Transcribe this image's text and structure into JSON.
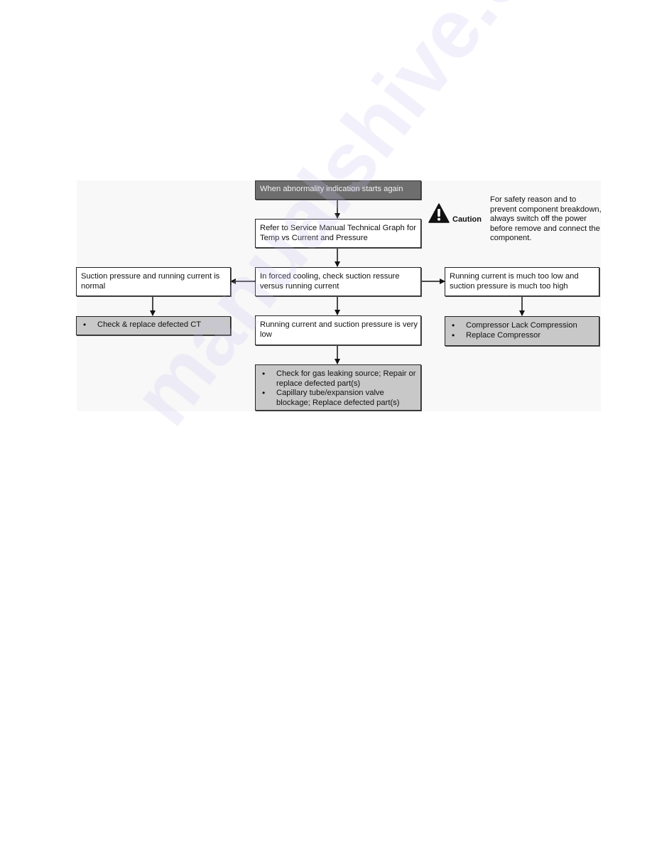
{
  "flowchart": {
    "start": "When abnormality indication starts again",
    "step_refer": "Refer to Service Manual Technical Graph for Temp vs Current and Pressure",
    "step_check": "In forced cooling, check suction ressure versus running current",
    "branch_left": "Suction pressure and running current is normal",
    "branch_middle": "Running current and suction pressure is very low",
    "branch_right": "Running current is much too low and suction pressure is much too high",
    "result_left": [
      "Check & replace defected CT"
    ],
    "result_middle": [
      "Check for gas leaking source; Repair or replace defected part(s)",
      "Capillary tube/expansion valve blockage; Replace defected part(s)"
    ],
    "result_right": [
      "Compressor Lack Compression",
      "Replace Compressor"
    ]
  },
  "caution": {
    "icon": "warning-triangle-icon",
    "label": "Caution",
    "text": "For safety reason and to prevent component breakdown, always switch off the power before remove and connect the component."
  },
  "watermark": "manualshive.com",
  "colors": {
    "start_box_fill": "#6e6e6e",
    "result_box_fill": "#c8c8c8",
    "step_box_fill": "#ffffff",
    "border": "#222222",
    "watermark": "#c8c4f0"
  }
}
